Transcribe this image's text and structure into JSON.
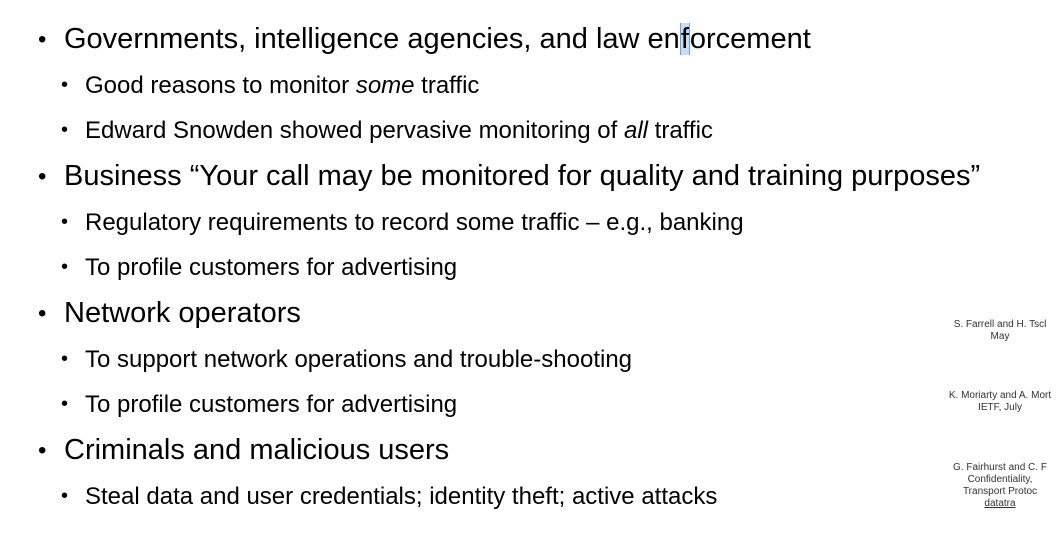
{
  "bullets": [
    {
      "text_before": "Governments, intelligence agencies, and law en",
      "text_cursor": "f",
      "text_after": "orcement",
      "children": [
        {
          "before": "Good reasons to monitor ",
          "emph": "some",
          "after": " traffic"
        },
        {
          "before": "Edward Snowden showed pervasive monitoring of ",
          "emph": "all",
          "after": " traffic"
        }
      ]
    },
    {
      "text": "Business “Your call may be monitored for quality and training purposes”",
      "children": [
        {
          "text": "Regulatory requirements to record some traffic – e.g., banking"
        },
        {
          "text": "To profile customers for advertising"
        }
      ]
    },
    {
      "text": "Network operators",
      "children": [
        {
          "text": "To support network operations and trouble-shooting"
        },
        {
          "text": "To profile customers for advertising"
        }
      ]
    },
    {
      "text": "Criminals and malicious users",
      "children": [
        {
          "text": "Steal data and user credentials; identity theft; active attacks"
        }
      ]
    }
  ],
  "bullet_glyph": "•",
  "references": [
    {
      "lines": [
        "S. Farrell and H. Tscl",
        "May"
      ]
    },
    {
      "lines": [
        "K. Moriarty and A. Mort",
        "IETF, July"
      ]
    },
    {
      "lines": [
        "G. Fairhurst and C. F",
        "Confidentiality,",
        "Transport Protoc"
      ],
      "link": "datatra"
    }
  ]
}
